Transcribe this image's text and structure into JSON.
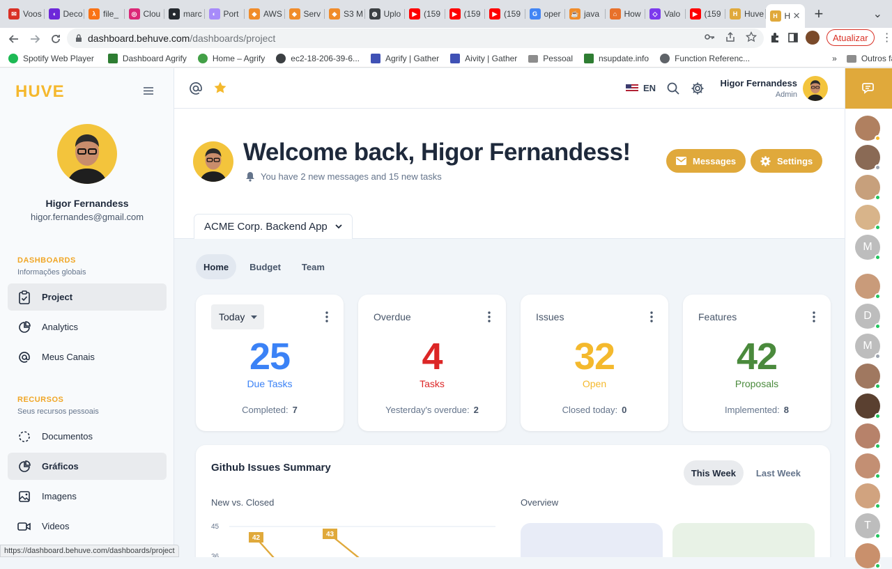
{
  "browser": {
    "tabs": [
      "Voos",
      "Deco",
      "file_",
      "Clou",
      "marc",
      "Port",
      "AWS",
      "Serv",
      "S3 M",
      "Uplo",
      "(159",
      "(159",
      "(159",
      "oper",
      "java",
      "How",
      "Valo",
      "(159",
      "Huve",
      "H"
    ],
    "url_host": "dashboard.behuve.com",
    "url_path": "/dashboards/project",
    "update_label": "Atualizar",
    "bookmarks": [
      "Spotify Web Player",
      "Dashboard Agrify",
      "Home – Agrify",
      "ec2-18-206-39-6...",
      "Agrify | Gather",
      "Aivity | Gather",
      "Pessoal",
      "nsupdate.info",
      "Function Referenc..."
    ],
    "bookmarks_more": "»",
    "other_bookmarks": "Outros favoritos",
    "status_url": "https://dashboard.behuve.com/dashboards/project"
  },
  "sidebar": {
    "logo": "HUVE",
    "user_name": "Higor Fernandess",
    "user_email": "higor.fernandes@gmail.com",
    "group1_title": "DASHBOARDS",
    "group1_sub": "Informações globais",
    "group1_items": [
      "Project",
      "Analytics",
      "Meus Canais"
    ],
    "group2_title": "RECURSOS",
    "group2_sub": "Seus recursos pessoais",
    "group2_items": [
      "Documentos",
      "Gráficos",
      "Imagens",
      "Videos"
    ]
  },
  "topbar": {
    "lang": "EN",
    "user_name": "Higor Fernandess",
    "user_role": "Admin"
  },
  "hero": {
    "title": "Welcome back, Higor Fernandess!",
    "subtitle": "You have 2 new messages and 15 new tasks",
    "messages_btn": "Messages",
    "settings_btn": "Settings",
    "project": "ACME Corp. Backend App"
  },
  "subtabs": [
    "Home",
    "Budget",
    "Team"
  ],
  "cards": {
    "due": {
      "filter": "Today",
      "value": "25",
      "label": "Due Tasks",
      "foot_label": "Completed:",
      "foot_value": "7"
    },
    "overdue": {
      "title": "Overdue",
      "value": "4",
      "label": "Tasks",
      "foot_label": "Yesterday's overdue:",
      "foot_value": "2"
    },
    "issues": {
      "title": "Issues",
      "value": "32",
      "label": "Open",
      "foot_label": "Closed today:",
      "foot_value": "0"
    },
    "features": {
      "title": "Features",
      "value": "42",
      "label": "Proposals",
      "foot_label": "Implemented:",
      "foot_value": "8"
    }
  },
  "github": {
    "title": "Github Issues Summary",
    "this_week": "This Week",
    "last_week": "Last Week",
    "left_title": "New vs. Closed",
    "right_title": "Overview",
    "axis_labels": [
      "45",
      "36"
    ],
    "point_labels": [
      "42",
      "43"
    ]
  },
  "contacts": [
    "",
    "",
    "",
    "",
    "M",
    "",
    "D",
    "M",
    "",
    "",
    "",
    "",
    "",
    "T",
    ""
  ],
  "colors": {
    "accent": "#e0a93b",
    "blue": "#3b82f6",
    "red": "#dc2626",
    "amber": "#f4b92d",
    "green": "#4a8a3c"
  }
}
